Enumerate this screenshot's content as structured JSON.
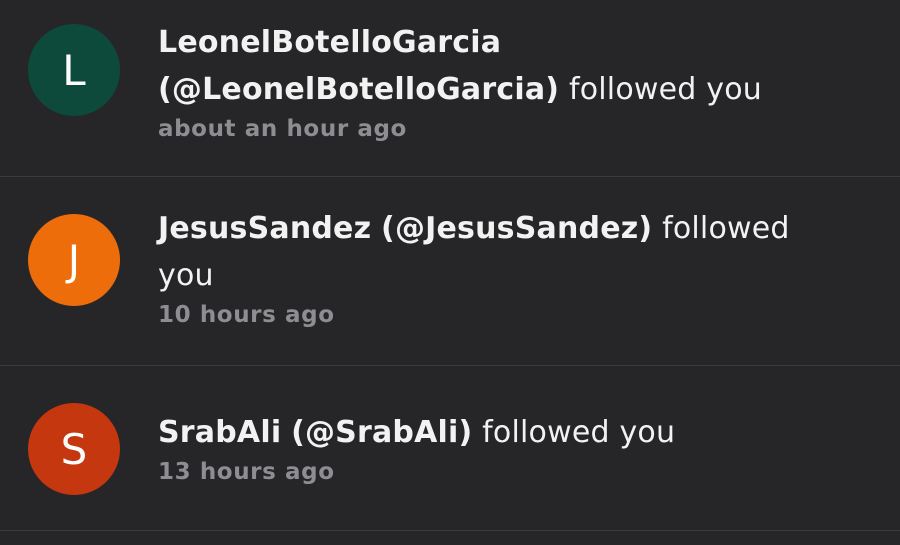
{
  "notifications": [
    {
      "avatar_letter": "L",
      "avatar_color": "#0d4a3c",
      "display_name": "LeonelBotelloGarcia",
      "handle": "(@LeonelBotelloGarcia)",
      "action": "followed you",
      "time": "about an hour ago"
    },
    {
      "avatar_letter": "J",
      "avatar_color": "#ee6d0b",
      "display_name": "JesusSandez",
      "handle": "(@JesusSandez)",
      "action": "followed you",
      "time": "10 hours ago"
    },
    {
      "avatar_letter": "S",
      "avatar_color": "#c5370f",
      "display_name": "SrabAli",
      "handle": "(@SrabAli)",
      "action": "followed you",
      "time": "13 hours ago"
    }
  ]
}
